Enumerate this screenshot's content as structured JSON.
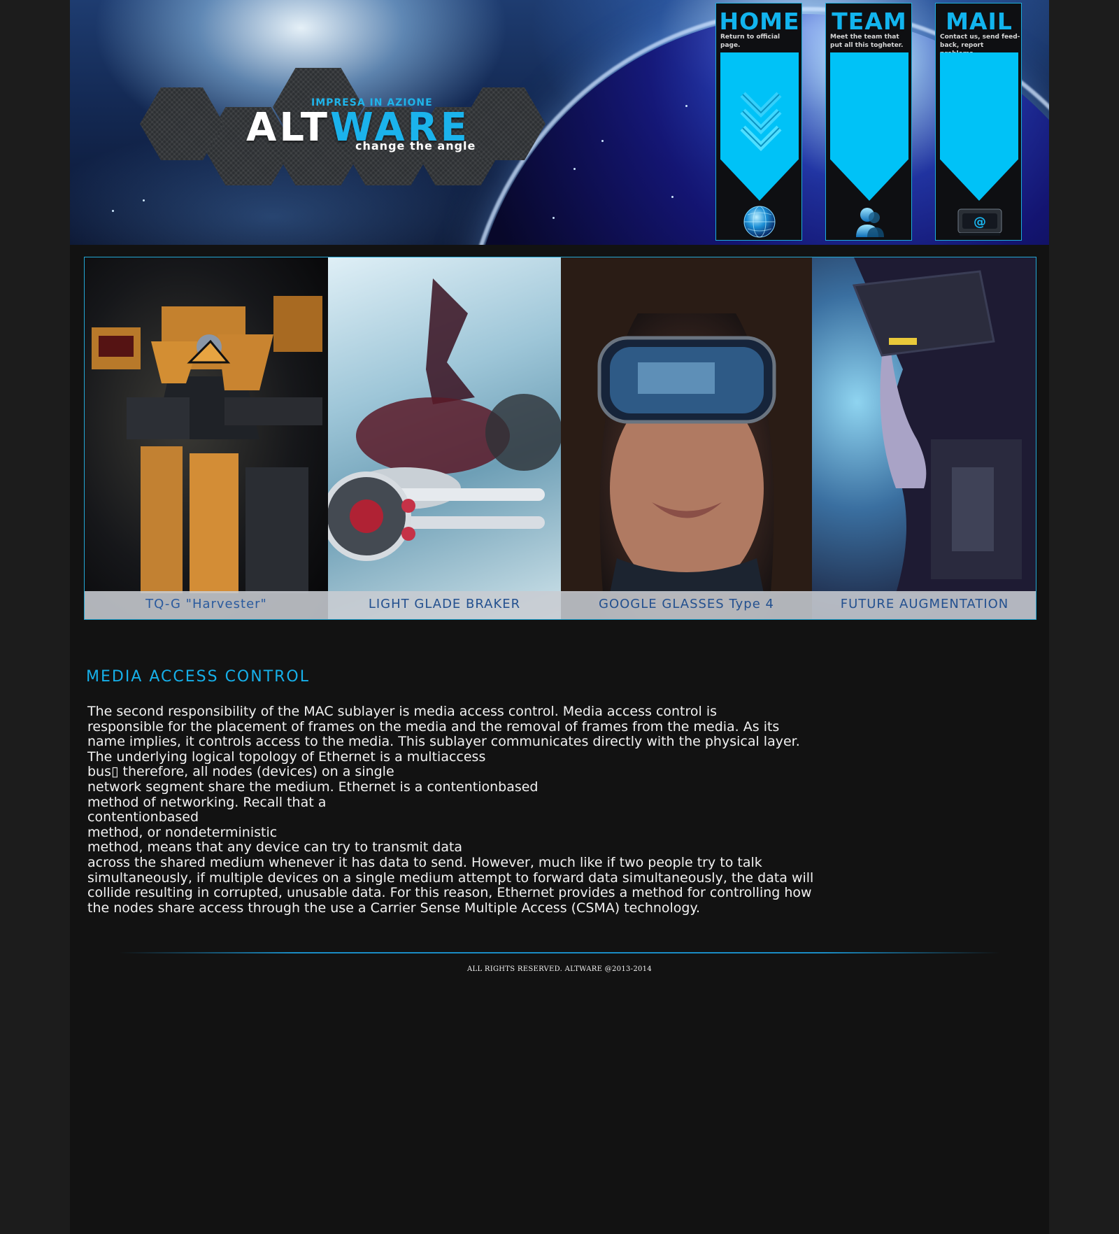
{
  "brand": {
    "tagline": "IMPRESA IN AZIONE",
    "name_part1": "ALT",
    "name_part2": "WARE",
    "slogan": "change the angle",
    "accent_color": "#1bb3ec"
  },
  "nav": [
    {
      "title": "HOME",
      "desc": "Return to official page.",
      "icon": "globe-icon"
    },
    {
      "title": "TEAM",
      "desc": "Meet the team that put all this togheter.",
      "icon": "person-icon"
    },
    {
      "title": "MAIL",
      "desc": "Contact us, send feed-back, report problems.",
      "icon": "at-sign-icon"
    }
  ],
  "slider": {
    "slides": [
      {
        "caption": "TQ-G \"Harvester\""
      },
      {
        "caption": "LIGHT GLADE BRAKER"
      },
      {
        "caption": "GOOGLE GLASSES Type 4"
      },
      {
        "caption": "FUTURE AUGMENTATION"
      }
    ]
  },
  "article": {
    "title": "MEDIA ACCESS CONTROL",
    "body": "The second responsibility of the MAC sublayer is media access control. Media access control is\nresponsible for the placement of frames on the media and the removal of frames from the media. As its\nname implies, it controls access to the media. This sublayer communicates directly with the physical layer.\nThe underlying logical topology of Ethernet is a multiaccess\nbus▯ therefore, all nodes (devices) on a single\nnetwork segment share the medium. Ethernet is a contentionbased\nmethod of networking. Recall that a\ncontentionbased\nmethod, or nondeterministic\nmethod, means that any device can try to transmit data\nacross the shared medium whenever it has data to send. However, much like if two people try to talk\nsimultaneously, if multiple devices on a single medium attempt to forward data simultaneously, the data will\ncollide resulting in corrupted, unusable data. For this reason, Ethernet provides a method for controlling how\nthe nodes share access through the use a Carrier Sense Multiple Access (CSMA) technology."
  },
  "footer": {
    "text": "ALL RIGHTS RESERVED. ALTWARE @2013-2014"
  }
}
